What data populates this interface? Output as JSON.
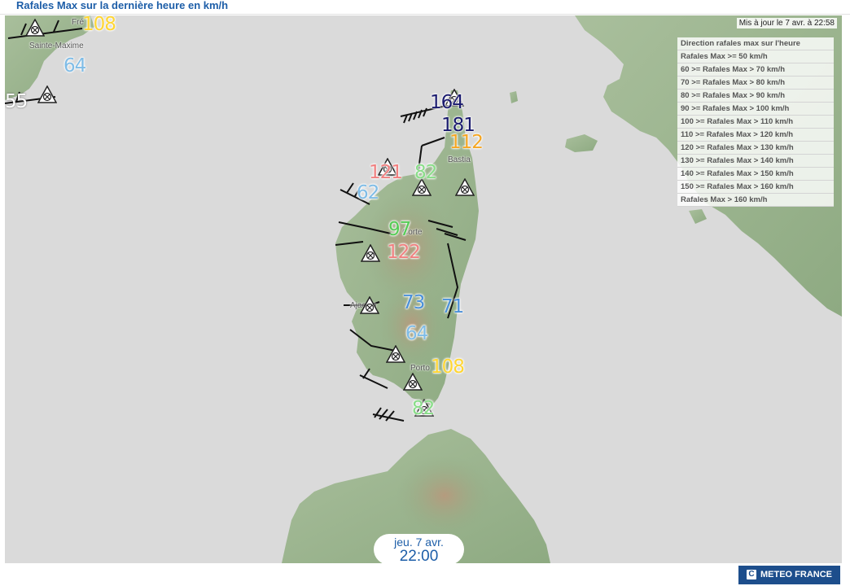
{
  "page": {
    "title": "Rafales Max sur la dernière heure en km/h"
  },
  "map": {
    "updated": "Mis à jour le 7 avr. à 22:58",
    "legend": [
      "Direction rafales max sur l'heure",
      "Rafales Max >= 50 km/h",
      "60 >= Rafales Max > 70 km/h",
      "70 >= Rafales Max > 80 km/h",
      "80 >= Rafales Max > 90 km/h",
      "90 >= Rafales Max > 100 km/h",
      "100 >= Rafales Max > 110 km/h",
      "110 >= Rafales Max > 120 km/h",
      "120 >= Rafales Max > 130 km/h",
      "130 >= Rafales Max > 140 km/h",
      "140 >= Rafales Max > 150 km/h",
      "150 >= Rafales Max > 160 km/h",
      "Rafales Max > 160 km/h"
    ],
    "colors": {
      "sea": "#dadada",
      "land": "#9db592",
      "v60_70": "#7fbce6",
      "v70_80": "#4a90d9",
      "v80_90": "#88dd88",
      "v90_100": "#55cc55",
      "v100_110": "#ffd633",
      "v110_120": "#f5a623",
      "v120_130": "#f08080",
      "v160_plus": "#1a1a6e"
    },
    "places": [
      "Fré",
      "Sainte-Maxime",
      "Bastia",
      "Corte",
      "Ajaccio",
      "Porto"
    ],
    "values": [
      "108",
      "64",
      "55",
      "164",
      "181",
      "112",
      "121",
      "82",
      "62",
      "97",
      "122",
      "73",
      "71",
      "64",
      "108",
      "82"
    ],
    "time": {
      "day": "jeu. 7 avr.",
      "hour": "22:00"
    },
    "brand": "METEO FRANCE"
  }
}
